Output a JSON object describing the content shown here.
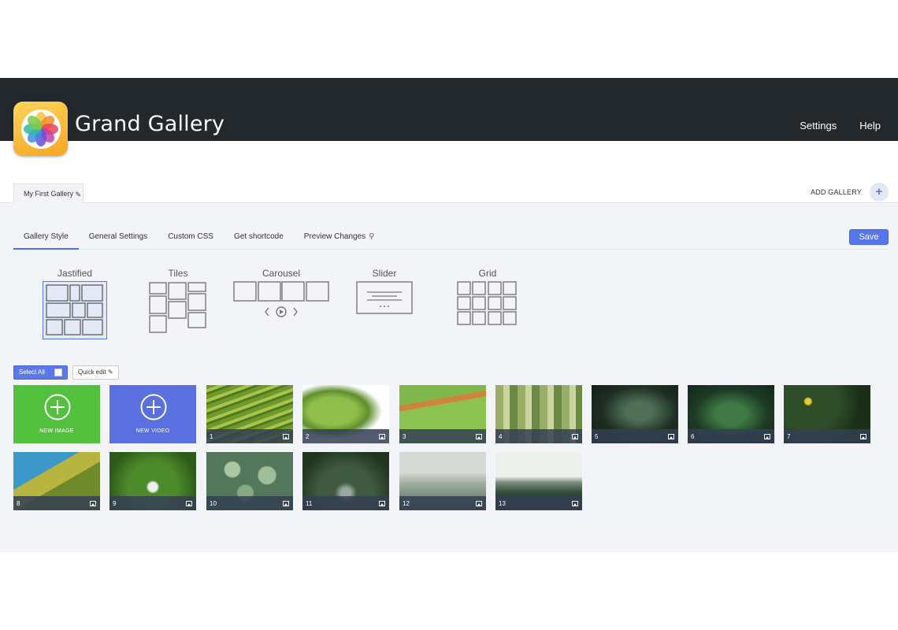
{
  "app": {
    "title": "Grand Gallery"
  },
  "top_nav": [
    {
      "label": "Settings"
    },
    {
      "label": "Help"
    }
  ],
  "gallery_tab": {
    "label": "My First Gallery"
  },
  "add_gallery": {
    "label": "ADD GALLERY"
  },
  "settings_tabs": [
    {
      "label": "Gallery Style",
      "active": true
    },
    {
      "label": "General Settings"
    },
    {
      "label": "Custom CSS"
    },
    {
      "label": "Get shortcode"
    },
    {
      "label": "Preview Changes"
    }
  ],
  "save_label": "Save",
  "styles": [
    {
      "label": "Jastified",
      "selected": true
    },
    {
      "label": "Tiles"
    },
    {
      "label": "Carousel"
    },
    {
      "label": "Slider"
    },
    {
      "label": "Grid"
    }
  ],
  "toolbar": {
    "select_all": "Select All",
    "quick_edit": "Quick edit"
  },
  "new_image_label": "NEW IMAGE",
  "new_video_label": "NEW VIDEO",
  "items": [
    {
      "number": "1"
    },
    {
      "number": "2"
    },
    {
      "number": "3"
    },
    {
      "number": "4"
    },
    {
      "number": "5"
    },
    {
      "number": "6"
    },
    {
      "number": "7"
    },
    {
      "number": "8"
    },
    {
      "number": "9"
    },
    {
      "number": "10"
    },
    {
      "number": "11"
    },
    {
      "number": "12"
    },
    {
      "number": "13"
    }
  ],
  "colors": {
    "header": "#23282d",
    "accent": "#5576ec",
    "new_image": "#53c13e",
    "new_video": "#5a6fe0",
    "panel": "#f3f4f8"
  }
}
